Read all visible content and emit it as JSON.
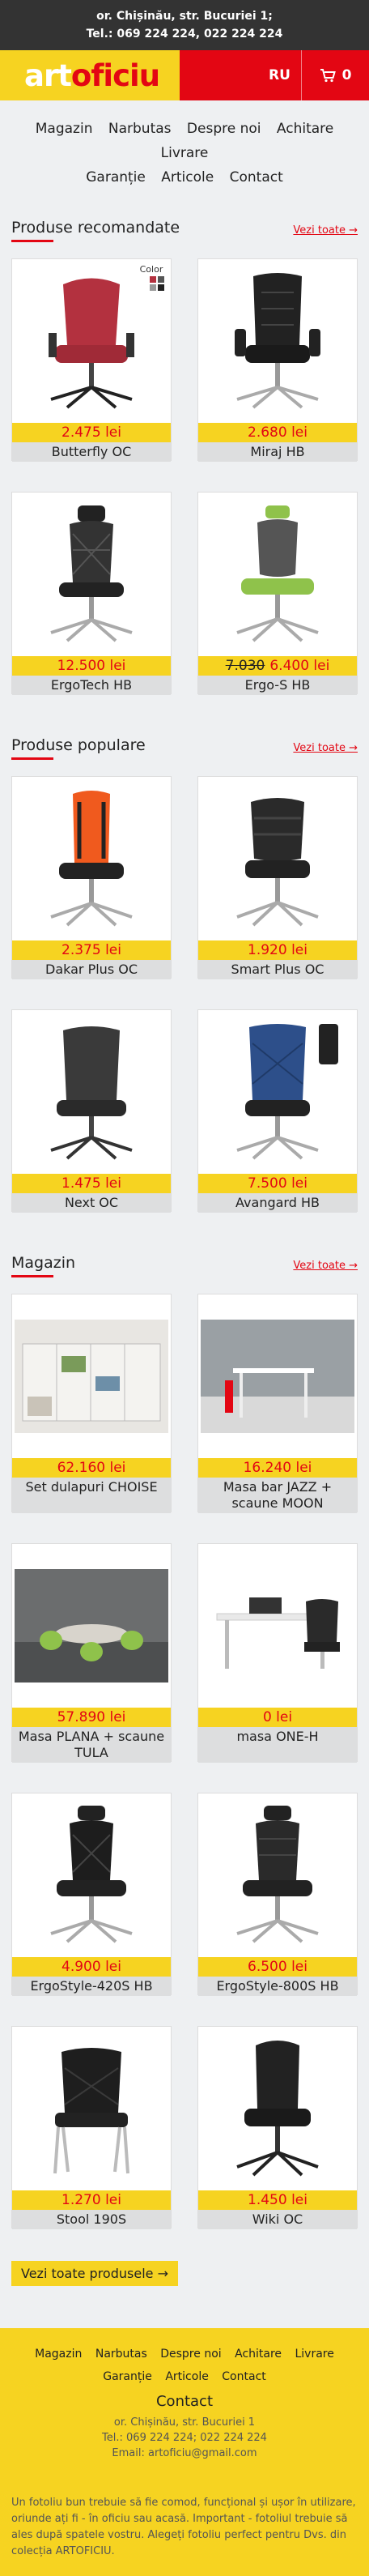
{
  "topbar": {
    "address": "or. Chișinău, str. Bucuriei 1;",
    "phone": "Tel.: 069 224 224, 022 224 224"
  },
  "brand": {
    "logo_part1": "art",
    "logo_part2": "oficiu",
    "lang": "RU",
    "cart_count": "0"
  },
  "nav": [
    "Magazin",
    "Narbutas",
    "Despre noi",
    "Achitare",
    "Livrare",
    "Garanție",
    "Articole",
    "Contact"
  ],
  "sections": [
    {
      "title": "Produse recomandate",
      "link": "Vezi toate →",
      "items": [
        {
          "name": "Butterfly OC",
          "price": "2.475 lei",
          "badge": "Color"
        },
        {
          "name": "Miraj HB",
          "price": "2.680 lei"
        },
        {
          "name": "ErgoTech HB",
          "price": "12.500 lei"
        },
        {
          "name": "Ergo-S HB",
          "old_price": "7.030",
          "price": "6.400 lei"
        }
      ]
    },
    {
      "title": "Produse populare",
      "link": "Vezi toate →",
      "items": [
        {
          "name": "Dakar Plus OC",
          "price": "2.375 lei"
        },
        {
          "name": "Smart Plus OC",
          "price": "1.920 lei"
        },
        {
          "name": "Next OC",
          "price": "1.475 lei"
        },
        {
          "name": "Avangard HB",
          "price": "7.500 lei"
        }
      ]
    },
    {
      "title": "Magazin",
      "link": "Vezi toate →",
      "items": [
        {
          "name": "Set dulapuri CHOISE",
          "price": "62.160 lei"
        },
        {
          "name": "Masa bar JAZZ + scaune MOON",
          "price": "16.240 lei"
        },
        {
          "name": "Masa PLANA + scaune TULA",
          "price": "57.890 lei"
        },
        {
          "name": "masa ONE-H",
          "price": "0 lei"
        },
        {
          "name": "ErgoStyle-420S HB",
          "price": "4.900 lei"
        },
        {
          "name": "ErgoStyle-800S HB",
          "price": "6.500 lei"
        },
        {
          "name": "Stool 190S",
          "price": "1.270 lei"
        },
        {
          "name": "Wiki OC",
          "price": "1.450 lei"
        }
      ],
      "button": "Vezi toate produsele →"
    }
  ],
  "footer": {
    "nav": [
      "Magazin",
      "Narbutas",
      "Despre noi",
      "Achitare",
      "Livrare",
      "Garanție",
      "Articole",
      "Contact"
    ],
    "title": "Contact",
    "address": "or. Chișinău, str. Bucuriei 1",
    "phones": "Tel.: 069 224 224; 022 224 224",
    "email": "Email: artoficiu@gmail.com",
    "about": "Un fotoliu bun trebuie să fie comod, funcțional și ușor în utilizare, oriunde ați fi - în oficiu sau acasă. Important - fotoliul trebuie să ales după spatele vostru. Alegeți fotoliu perfect pentru Dvs. din colecția ARTOFICIU."
  },
  "colors": {
    "accent_red": "#e30613",
    "accent_yellow": "#f6d321",
    "dark": "#333333"
  }
}
